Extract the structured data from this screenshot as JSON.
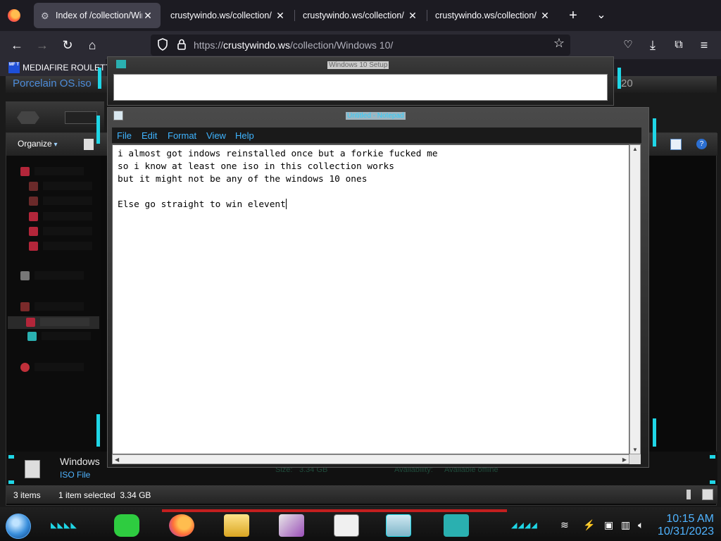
{
  "browser": {
    "tabs": [
      {
        "title": "Index of /collection/Win",
        "active": true
      },
      {
        "title": "crustywindo.ws/collection/",
        "active": false
      },
      {
        "title": "crustywindo.ws/collection/",
        "active": false
      },
      {
        "title": "crustywindo.ws/collection/",
        "active": false
      }
    ],
    "url_prefix": "https://",
    "url_host": "crustywindo.ws",
    "url_path": "/collection/Windows 10/",
    "bookmark": {
      "badge": "MF T",
      "label": "MEDIAFIRE ROULETT"
    }
  },
  "setup_window": {
    "title": "Windows 10 Setup"
  },
  "explorer": {
    "address_left": "Porcelain OS.iso",
    "address_right": "20",
    "organize": "Organize",
    "detail": {
      "name": "Windows",
      "type": "ISO File",
      "size_label": "Size:",
      "size": "3.34 GB",
      "availability_label": "Availability:",
      "availability": "Available offline"
    },
    "status": {
      "items": "3 items",
      "selected": "1 item selected  3.34 GB"
    }
  },
  "notepad": {
    "title": "Untitled - Notepad",
    "menu": [
      "File",
      "Edit",
      "Format",
      "View",
      "Help"
    ],
    "text": "i almost got indows reinstalled once but a forkie fucked me\nso i know at least one iso in this collection works\nbut it might not be any of the windows 10 ones\n\nElse go straight to win elevent"
  },
  "taskbar": {
    "time": "10:15 AM",
    "date": "10/31/2023",
    "colors": {
      "accent": "#1fd6e6",
      "clock": "#4fb3ff",
      "red": "#c41f1f"
    }
  }
}
